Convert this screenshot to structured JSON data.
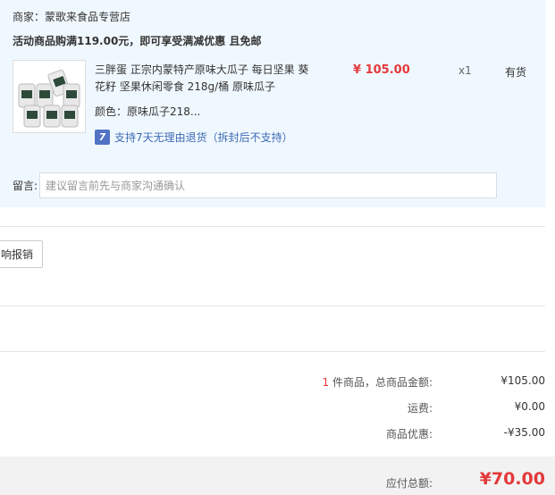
{
  "shop": {
    "merchant_label": "商家：",
    "merchant_name": "蒙歌来食品专营店",
    "promo_text": "活动商品购满119.00元，即可享受满减优惠 且免邮"
  },
  "item": {
    "name": "三胖蛋 正宗内蒙特产原味大瓜子 每日坚果 葵花籽 坚果休闲零食 218g/桶 原味瓜子",
    "color_label": "颜色：",
    "color_value": "原味瓜子218...",
    "return_icon_text": "7",
    "return_text": "支持7天无理由退货（拆封后不支持）",
    "price": "¥ 105.00",
    "qty": "x1",
    "stock": "有货"
  },
  "message": {
    "label": "留言:",
    "placeholder": "建议留言前先与商家沟通确认"
  },
  "reimbursement": {
    "button_label": "响报销"
  },
  "summary": {
    "count": "1",
    "items_total_label": " 件商品，总商品金额:",
    "items_total_value": "¥105.00",
    "shipping_label": "运费:",
    "shipping_value": "¥0.00",
    "discount_label": "商品优惠:",
    "discount_value": "-¥35.00",
    "payable_label": "应付总额:",
    "payable_value": "¥70.00"
  },
  "colors": {
    "accent_red": "#e4393c",
    "panel_bg": "#f0f8ff",
    "link_blue": "#3d6ab5"
  }
}
